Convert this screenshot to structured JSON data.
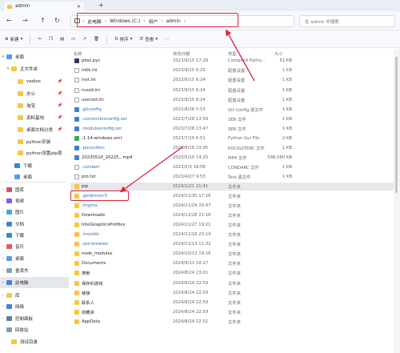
{
  "window": {
    "tab_title": "admin",
    "new_tab": "+"
  },
  "address": {
    "crumbs": [
      "此电脑",
      "Windows (C:)",
      "用户",
      "admin"
    ],
    "search_placeholder": "在 admin 中搜索"
  },
  "toolbar": {
    "new_label": "新建",
    "sort_label": "排序",
    "view_label": "查看"
  },
  "sidebar": {
    "items": [
      {
        "label": "桌面",
        "arrow": "▾"
      },
      {
        "label": "主文件夹",
        "arrow": "▾"
      },
      {
        "label": "vedios",
        "arrow": ""
      },
      {
        "label": "办公",
        "arrow": ""
      },
      {
        "label": "淘宝",
        "arrow": ""
      },
      {
        "label": "资料基地",
        "arrow": ""
      },
      {
        "label": "桌面文档分类",
        "arrow": ""
      },
      {
        "label": "python安装",
        "arrow": ""
      },
      {
        "label": "python设置pip源",
        "arrow": ""
      },
      {
        "label": "下载",
        "arrow": ""
      },
      {
        "label": "桌面",
        "arrow": ""
      },
      {
        "label": "图库",
        "arrow": "›"
      },
      {
        "label": "视频",
        "arrow": "›"
      },
      {
        "label": "图片",
        "arrow": "›"
      },
      {
        "label": "文档",
        "arrow": "›"
      },
      {
        "label": "下载",
        "arrow": "›"
      },
      {
        "label": "音乐",
        "arrow": "›"
      },
      {
        "label": "桌面",
        "arrow": "›"
      },
      {
        "label": "垂漆杰",
        "arrow": "›"
      },
      {
        "label": "此电脑",
        "arrow": "›"
      },
      {
        "label": "库",
        "arrow": "›"
      },
      {
        "label": "网络",
        "arrow": "›"
      },
      {
        "label": "控制面板",
        "arrow": "›"
      },
      {
        "label": "回收站",
        "arrow": ""
      },
      {
        "label": "测试目录",
        "arrow": ""
      }
    ]
  },
  "columns": {
    "name": "名称",
    "date": "修改日期",
    "type": "类型",
    "size": "大小"
  },
  "files": [
    {
      "name": "pbss.pyc",
      "date": "2023/9/15 17:28",
      "type": "Compiled Pytho...",
      "size": "51 KB"
    },
    {
      "name": "initk.ini",
      "date": "2023/9/15 6:25",
      "type": "配置设置",
      "size": "1 KB"
    },
    {
      "name": "inst.ini",
      "date": "2023/9/15 6:24",
      "type": "配置设置",
      "size": "1 KB"
    },
    {
      "name": "nuuid.ini",
      "date": "2023/9/15 6:24",
      "type": "配置设置",
      "size": "1 KB"
    },
    {
      "name": "useruid.ini",
      "date": "2023/9/15 6:24",
      "type": "配置设置",
      "size": "1 KB"
    },
    {
      "name": ".gitconfig",
      "date": "2023/8/26 5:53",
      "type": "Git Config 源文件",
      "size": "1 KB"
    },
    {
      "name": ".connectionconfig.ser",
      "date": "2023/7/28 13:59",
      "type": "SER 文件",
      "size": "1 KB"
    },
    {
      "name": ".modulesconfig.ser",
      "date": "2023/7/28 13:47",
      "type": "SER 文件",
      "size": "1 KB"
    },
    {
      "name": "-1.14-windows.xml",
      "date": "2023/7/10 6:51",
      "type": "Python Gui File",
      "size": "2 KB"
    },
    {
      "name": ".pocsuiterc",
      "date": "2023/6/18 23:05",
      "type": "POCSUITERC 文件",
      "size": "1 KB"
    },
    {
      "name": "20230510_20225...mp4",
      "date": "2023/5/10 14:25",
      "type": "MP4 文件",
      "size": "598,080 KB"
    },
    {
      "name": ".condarc",
      "date": "2023/5/3 18:58",
      "type": "CONDARC 文件",
      "size": "1 KB"
    },
    {
      "name": "pro.txt",
      "date": "2023/4/27 9:53",
      "type": "Text 源文件",
      "size": "1 KB"
    },
    {
      "name": "pip",
      "date": "2024/12/1 21:41",
      "type": "文件夹",
      "size": ""
    },
    {
      "name": ".goldminer3",
      "date": "2024/11/30 17:16",
      "type": "文件夹",
      "size": ""
    },
    {
      "name": ".lingma",
      "date": "2024/11/29 20:47",
      "type": "文件夹",
      "size": ""
    },
    {
      "name": "Downloads",
      "date": "2024/11/28 21:16",
      "type": "文件夹",
      "size": ""
    },
    {
      "name": "IntelGraphicsProfiles",
      "date": "2024/11/27 19:21",
      "type": "文件夹",
      "size": ""
    },
    {
      "name": ".mootdx",
      "date": "2024/11/16 23:14",
      "type": "文件夹",
      "size": ""
    },
    {
      "name": ".oss-browser",
      "date": "2024/11/13 11:32",
      "type": "文件夹",
      "size": ""
    },
    {
      "name": "node_modules",
      "date": "2024/10/13 19:16",
      "type": "文件夹",
      "size": ""
    },
    {
      "name": "Documents",
      "date": "2024/9/13 18:27",
      "type": "文件夹",
      "size": ""
    },
    {
      "name": "搜索",
      "date": "2024/8/24 23:01",
      "type": "文件夹",
      "size": ""
    },
    {
      "name": "保存的游戏",
      "date": "2024/8/24 22:59",
      "type": "文件夹",
      "size": ""
    },
    {
      "name": "链接",
      "date": "2024/8/24 22:59",
      "type": "文件夹",
      "size": ""
    },
    {
      "name": "联系人",
      "date": "2024/8/24 22:59",
      "type": "文件夹",
      "size": ""
    },
    {
      "name": "收藏夹",
      "date": "2024/8/24 22:59",
      "type": "文件夹",
      "size": ""
    },
    {
      "name": "AppData",
      "date": "2024/8/24 22:51",
      "type": "文件夹",
      "size": ""
    }
  ],
  "colors": {
    "accent": "#e0243a",
    "folder": "#f6c744"
  }
}
